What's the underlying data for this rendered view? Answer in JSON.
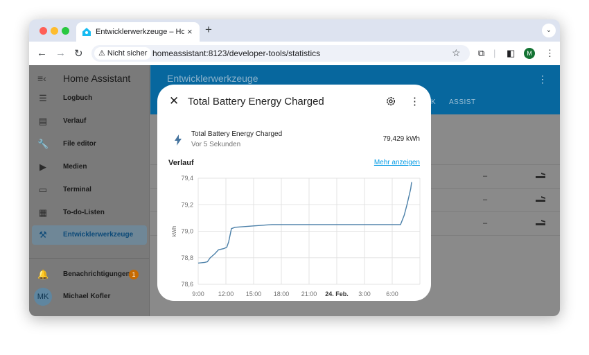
{
  "browser": {
    "tab_title": "Entwicklerwerkzeuge – Home Assistant",
    "tab_close": "×",
    "new_tab": "+",
    "tab_menu": "⌄",
    "insecure_label": "Nicht sicher",
    "url": "homeassistant:8123/developer-tools/statistics",
    "profile_initial": "M",
    "icons": [
      "back-icon",
      "forward-icon",
      "reload-icon",
      "star-icon",
      "extensions-icon",
      "sidepanel-icon",
      "menu-icon"
    ]
  },
  "sidebar": {
    "title": "Home Assistant",
    "items": [
      {
        "label": "Logbuch",
        "icon": "list-icon"
      },
      {
        "label": "Verlauf",
        "icon": "chart-icon"
      },
      {
        "label": "File editor",
        "icon": "wrench-icon"
      },
      {
        "label": "Medien",
        "icon": "play-icon"
      },
      {
        "label": "Terminal",
        "icon": "terminal-icon"
      },
      {
        "label": "To-do-Listen",
        "icon": "clipboard-icon"
      },
      {
        "label": "Entwicklerwerkzeuge",
        "icon": "hammer-icon",
        "active": true
      }
    ],
    "notifications": {
      "label": "Benachrichtigungen",
      "count": "1"
    },
    "user": {
      "initials": "MK",
      "name": "Michael Kofler"
    }
  },
  "main": {
    "title": "Entwicklerwerkzeuge",
    "tab_partial": "K",
    "tab_assist": "ASSIST",
    "rows": [
      {
        "value": "–"
      },
      {
        "value": "–"
      },
      {
        "value": "–"
      }
    ]
  },
  "dialog": {
    "close": "✕",
    "title": "Total Battery Energy Charged",
    "entity_name": "Total Battery Energy Charged",
    "entity_updated": "Vor 5 Sekunden",
    "entity_value": "79,429 kWh",
    "history_title": "Verlauf",
    "history_more": "Mehr anzeigen"
  },
  "chart_data": {
    "type": "line",
    "ylabel": "kWh",
    "ylim": [
      78.6,
      79.4
    ],
    "y_ticks": [
      "79,4",
      "79,2",
      "79,0",
      "78,8",
      "78,6"
    ],
    "x_ticks": [
      "9:00",
      "12:00",
      "15:00",
      "18:00",
      "21:00",
      "24. Feb.",
      "3:00",
      "6:00"
    ],
    "x_hours": [
      0,
      3,
      6,
      9,
      12,
      15,
      18,
      21
    ],
    "xlim": [
      0,
      24
    ],
    "line_color": "#4a7fa8",
    "series": [
      {
        "points": [
          [
            0,
            78.76
          ],
          [
            0.7,
            78.765
          ],
          [
            1.0,
            78.77
          ],
          [
            1.3,
            78.8
          ],
          [
            1.8,
            78.83
          ],
          [
            2.2,
            78.86
          ],
          [
            2.8,
            78.87
          ],
          [
            3.1,
            78.88
          ],
          [
            3.3,
            78.92
          ],
          [
            3.6,
            79.02
          ],
          [
            4.0,
            79.03
          ],
          [
            6.0,
            79.04
          ],
          [
            8.0,
            79.05
          ],
          [
            15.0,
            79.05
          ],
          [
            20.0,
            79.05
          ],
          [
            21.9,
            79.05
          ],
          [
            22.3,
            79.12
          ],
          [
            22.6,
            79.2
          ],
          [
            23.0,
            79.32
          ],
          [
            23.1,
            79.37
          ]
        ]
      }
    ]
  }
}
